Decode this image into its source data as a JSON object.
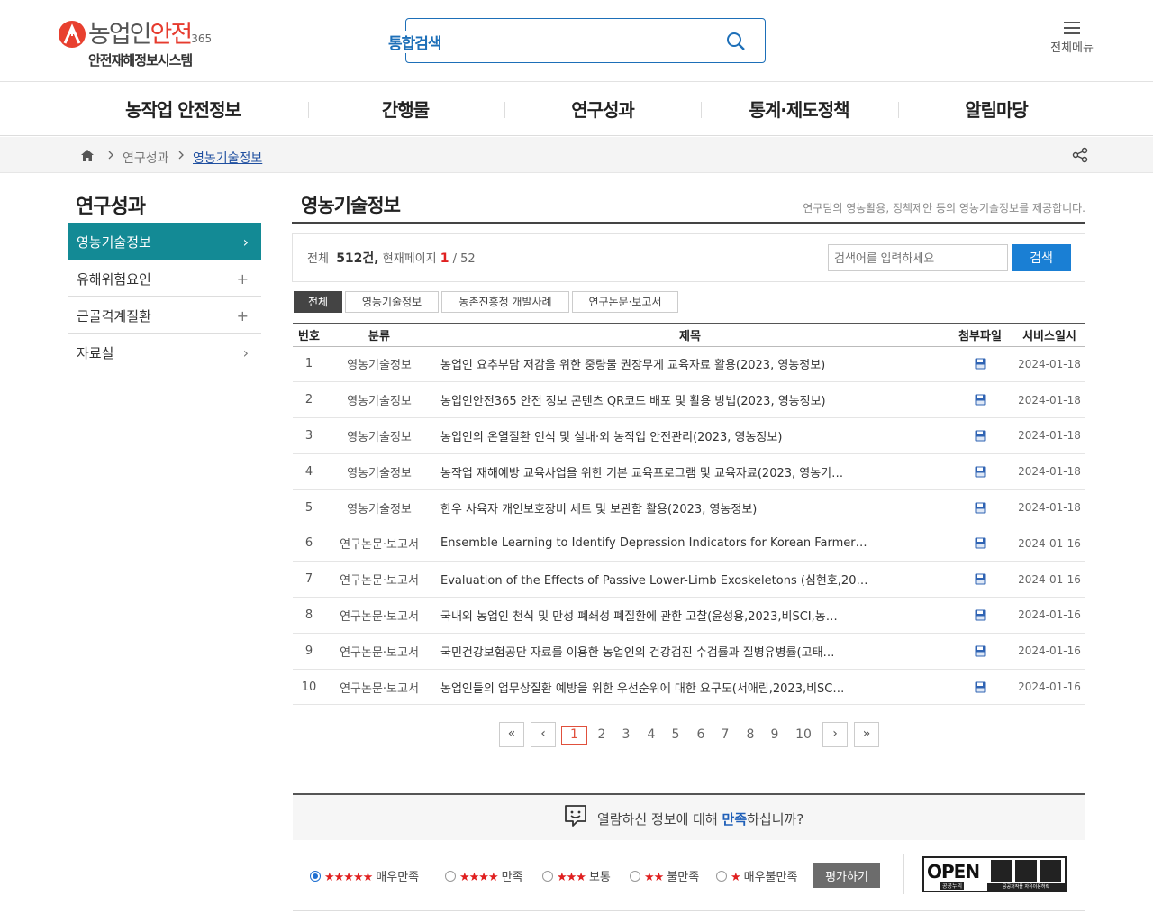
{
  "header": {
    "logo_main_prefix": "농업인",
    "logo_main_highlight": "안전",
    "logo_main_suffix": "365",
    "logo_sub": "안전재해정보시스템",
    "search_label": "통합검색",
    "all_menu_label": "전체메뉴"
  },
  "gnb": [
    "농작업 안전정보",
    "간행물",
    "연구성과",
    "통계·제도정책",
    "알림마당"
  ],
  "breadcrumb": {
    "parent": "연구성과",
    "current": "영농기술정보"
  },
  "side": {
    "title": "연구성과",
    "items": [
      {
        "label": "영농기술정보",
        "mark": "›"
      },
      {
        "label": "유해위험요인",
        "mark": "+"
      },
      {
        "label": "근골격계질환",
        "mark": "+"
      },
      {
        "label": "자료실",
        "mark": "›"
      }
    ]
  },
  "content": {
    "title": "영농기술정보",
    "description": "연구팀의 영농활용, 정책제안 등의 영농기술정보를 제공합니다.",
    "info": {
      "total_label": "전체",
      "total": "512건,",
      "page_label": "현재페이지",
      "current_page": "1",
      "page_sep": "/",
      "total_pages": "52"
    },
    "keyword_placeholder": "검색어를 입력하세요",
    "search_button": "검색",
    "tabs": [
      "전체",
      "영농기술정보",
      "농촌진흥청 개발사례",
      "연구논문·보고서"
    ],
    "columns": [
      "번호",
      "분류",
      "제목",
      "첨부파일",
      "서비스일시"
    ],
    "rows": [
      {
        "no": "1",
        "category": "영농기술정보",
        "title": "농업인 요추부담 저감을 위한 중량물 권장무게 교육자료 활용(2023, 영농정보)",
        "date": "2024-01-18"
      },
      {
        "no": "2",
        "category": "영농기술정보",
        "title": "농업인안전365 안전 정보 콘텐츠 QR코드 배포 및 활용 방법(2023, 영농정보)",
        "date": "2024-01-18"
      },
      {
        "no": "3",
        "category": "영농기술정보",
        "title": "농업인의 온열질환 인식 및 실내·외 농작업 안전관리(2023, 영농정보)",
        "date": "2024-01-18"
      },
      {
        "no": "4",
        "category": "영농기술정보",
        "title": "농작업 재해예방 교육사업을 위한 기본 교육프로그램 및 교육자료(2023, 영농기…",
        "date": "2024-01-18"
      },
      {
        "no": "5",
        "category": "영농기술정보",
        "title": "한우 사육자 개인보호장비 세트 및 보관함 활용(2023, 영농정보)",
        "date": "2024-01-18"
      },
      {
        "no": "6",
        "category": "연구논문·보고서",
        "title": "Ensemble Learning to Identify Depression Indicators for Korean Farmer…",
        "date": "2024-01-16"
      },
      {
        "no": "7",
        "category": "연구논문·보고서",
        "title": "Evaluation of the Effects of Passive Lower-Limb Exoskeletons (심현호,20…",
        "date": "2024-01-16"
      },
      {
        "no": "8",
        "category": "연구논문·보고서",
        "title": "국내외 농업인 천식 및 만성 폐쇄성 폐질환에 관한 고찰(윤성용,2023,비SCI,농…",
        "date": "2024-01-16"
      },
      {
        "no": "9",
        "category": "연구논문·보고서",
        "title": "국민건강보험공단 자료를 이용한 농업인의 건강검진 수검률과 질병유병률(고태…",
        "date": "2024-01-16"
      },
      {
        "no": "10",
        "category": "연구논문·보고서",
        "title": "농업인들의 업무상질환 예방을 위한 우선순위에 대한 요구도(서애림,2023,비SC…",
        "date": "2024-01-16"
      }
    ]
  },
  "pagination": {
    "first": "«",
    "prev": "‹",
    "pages": [
      "1",
      "2",
      "3",
      "4",
      "5",
      "6",
      "7",
      "8",
      "9",
      "10"
    ],
    "current": "1",
    "next": "›",
    "last": "»"
  },
  "satisfaction": {
    "question_pre": "열람하신 정보에 대해 ",
    "question_hl": "만족",
    "question_post": "하십니까?",
    "options": [
      {
        "stars": "★★★★★",
        "label": "매우만족",
        "selected": true
      },
      {
        "stars": "★★★★",
        "label": "만족",
        "selected": false
      },
      {
        "stars": "★★★",
        "label": "보통",
        "selected": false
      },
      {
        "stars": "★★",
        "label": "불만족",
        "selected": false
      },
      {
        "stars": "★",
        "label": "매우불만족",
        "selected": false
      }
    ],
    "submit": "평가하기"
  },
  "license": {
    "open": "OPEN",
    "sub": "공공누리",
    "bar": "공공저작물 자유이용허락"
  },
  "colors": {
    "accent": "#138a95",
    "primary": "#1a7fd4",
    "highlight": "#e02020"
  },
  "icons": {
    "search": "search-icon",
    "menu": "hamburger-icon",
    "home": "home-icon",
    "share": "share-icon",
    "file": "floppy-disk-icon"
  }
}
